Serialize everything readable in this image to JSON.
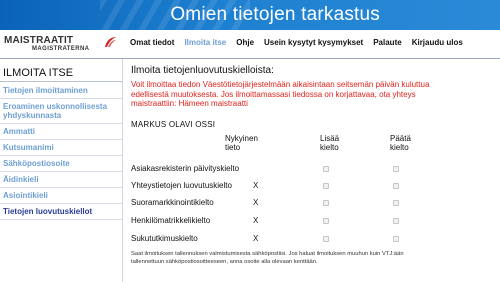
{
  "header": {
    "title": "Omien tietojen tarkastus"
  },
  "logo": {
    "line1": "MAISTRAATIT",
    "line2": "MAGISTRATERNA",
    "accent": "#d0262a"
  },
  "topnav": [
    {
      "label": "Omat tiedot",
      "active": false
    },
    {
      "label": "Ilmoita itse",
      "active": true
    },
    {
      "label": "Ohje",
      "active": false
    },
    {
      "label": "Usein kysytyt kysymykset",
      "active": false
    },
    {
      "label": "Palaute",
      "active": false
    },
    {
      "label": "Kirjaudu ulos",
      "active": false
    }
  ],
  "sidebar": {
    "heading": "ILMOITA ITSE",
    "items": [
      {
        "label": "Tietojen ilmoittaminen",
        "active": false
      },
      {
        "label": "Eroaminen uskonnollisesta yhdyskunnasta",
        "active": false
      },
      {
        "label": "Ammatti",
        "active": false
      },
      {
        "label": "Kutsumanimi",
        "active": false
      },
      {
        "label": "Sähköpostiosoite",
        "active": false
      },
      {
        "label": "Äidinkieli",
        "active": false
      },
      {
        "label": "Asiointikieli",
        "active": false
      },
      {
        "label": "Tietojen luovutuskiellot",
        "active": true
      }
    ]
  },
  "main": {
    "heading": "Ilmoita tietojenluovutuskielloista:",
    "alert": "Voit ilmoittaa tiedon Väestötietojärjestelmään aikaisintaan seitsemän päivän kuluttua edellisestä muutoksesta. Jos ilmoittamassasi tiedossa on korjattavaa, ota yhteys maistraattiin: Hämeen maistraatti",
    "person_name": "MARKUS OLAVI OSSI",
    "columns": {
      "current": "Nykyinen tieto",
      "add": "Lisää kielto",
      "end": "Päätä kielto"
    },
    "rows": [
      {
        "label": "Asiakasrekisterin päivityskielto",
        "current": ""
      },
      {
        "label": "Yhteystietojen luovutuskielto",
        "current": "X"
      },
      {
        "label": "Suoramarkkinointikielto",
        "current": "X"
      },
      {
        "label": "Henkilömatrikkelikielto",
        "current": "X"
      },
      {
        "label": "Sukututkimuskielto",
        "current": "X"
      }
    ],
    "note": "Saat ilmoituksen tallennuksen valmistumisesta sähköpostiisi. Jos haluat ilmoituksen muuhun kuin VTJ:ään tallennettuun sähköpostiosoitteeseen, anna osoite alla olevaan kenttään."
  }
}
